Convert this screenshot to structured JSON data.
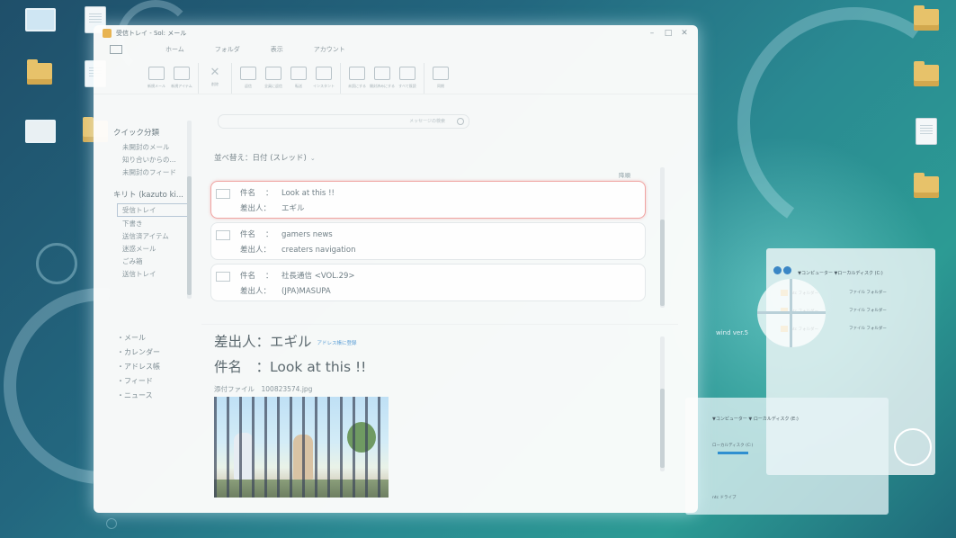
{
  "colors": {
    "desktop": "#26727f",
    "window_bg": "#fdfdfc",
    "selected_border": "#f0a4a2",
    "address_link": "#5c9fd6",
    "folder": "#e7c26a"
  },
  "window": {
    "title": "受信トレイ - Sol: メール",
    "app_icon": "folder-icon",
    "buttons": [
      "minimize",
      "maximize",
      "close"
    ]
  },
  "ribbon": {
    "tabs": [
      "ホーム",
      "フォルダ",
      "表示",
      "アカウント"
    ],
    "groups": [
      [
        "新規メール",
        "新規アイテム"
      ],
      [
        "削除"
      ],
      [
        "返信",
        "全員に返信",
        "転送",
        "インスタント"
      ],
      [
        "未読にする",
        "開封済みにする",
        "すべて既読"
      ],
      [
        "同期"
      ]
    ]
  },
  "sidebar": {
    "quick_heading": "クイック分類",
    "quick_items": [
      "未開封のメール",
      "知り合いからの...",
      "未開封のフィード"
    ],
    "account_heading": "キリト (kazuto ki...",
    "folders": [
      {
        "label": "受信トレイ",
        "selected": true
      },
      {
        "label": "下書き",
        "selected": false
      },
      {
        "label": "送信済アイテム",
        "selected": false
      },
      {
        "label": "迷惑メール",
        "selected": false
      },
      {
        "label": "ごみ箱",
        "selected": false
      },
      {
        "label": "送信トレイ",
        "selected": false
      }
    ],
    "nav": [
      "・メール",
      "・カレンダー",
      "・アドレス帳",
      "・フィード",
      "・ニュース"
    ]
  },
  "search": {
    "placeholder": "メッセージの検索"
  },
  "list": {
    "sort_label": "並べ替え：日付 (スレッド)",
    "top_link": "降順",
    "field_subject": "件名",
    "field_from": "差出人：",
    "colon": "：",
    "messages": [
      {
        "subject": "Look at this !!",
        "from": "エギル",
        "selected": true
      },
      {
        "subject": "gamers news",
        "from": "creaters navigation",
        "selected": false
      },
      {
        "subject": "社長通信 <VOL.29>",
        "from": "(JPA)MASUPA",
        "selected": false
      }
    ]
  },
  "preview": {
    "from_line": "差出人：エギル",
    "add_address": "アドレス帳に登録",
    "subject_line": "件名　：Look at this !!",
    "attachment": "添付ファイル　100823574.jpg"
  },
  "desktop": {
    "watermark": "wind ver.5",
    "explorer_title": "▼コンピューター ▼ローカルディスク (C:)",
    "explorer2_title": "▼コンピューター ▼ ローカルディスク (E:)",
    "explorer_rows": [
      {
        "name": "ntc フォルダー",
        "type": "ファイル フォルダー"
      },
      {
        "name": "ntc フォルダー",
        "type": "ファイル フォルダー"
      },
      {
        "name": "ntc フォルダー",
        "type": "ファイル フォルダー"
      }
    ],
    "disk_label": "ローカルディスク (C:)",
    "disk2_label": "ntc ドライブ"
  }
}
